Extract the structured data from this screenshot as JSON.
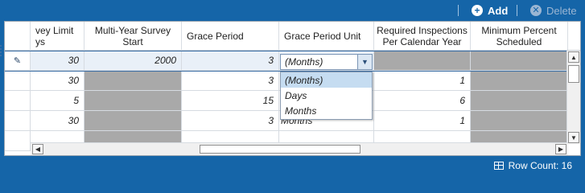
{
  "toolbar": {
    "add_label": "Add",
    "delete_label": "Delete",
    "add_icon": "plus-circle-icon",
    "delete_icon": "x-circle-icon"
  },
  "columns": [
    {
      "line1": "vey Limit",
      "line2": "ys"
    },
    {
      "line1": "Multi-Year Survey",
      "line2": "Start"
    },
    {
      "line1": "Grace Period",
      "line2": ""
    },
    {
      "line1": "Grace Period Unit",
      "line2": ""
    },
    {
      "line1": "Required Inspections",
      "line2": "Per Calendar Year"
    },
    {
      "line1": "Minimum Percent",
      "line2": "Scheduled"
    }
  ],
  "rows": [
    {
      "survey_limit": "30",
      "multi_year_start": "2000",
      "grace_period": "3",
      "grace_unit": "(Months)",
      "required": "",
      "minimum": ""
    },
    {
      "survey_limit": "30",
      "multi_year_start": "",
      "grace_period": "3",
      "grace_unit": "",
      "required": "1",
      "minimum": ""
    },
    {
      "survey_limit": "5",
      "multi_year_start": "",
      "grace_period": "15",
      "grace_unit": "",
      "required": "6",
      "minimum": ""
    },
    {
      "survey_limit": "30",
      "multi_year_start": "",
      "grace_period": "3",
      "grace_unit": "Months",
      "required": "1",
      "minimum": ""
    }
  ],
  "dropdown": {
    "selected": "(Months)",
    "options": [
      "(Months)",
      "Days",
      "Months"
    ]
  },
  "status": {
    "row_count": "Row Count:  16"
  },
  "colors": {
    "brand_blue": "#1565a8",
    "readonly_gray": "#a9a9a9",
    "highlight": "#c5dcf1"
  }
}
